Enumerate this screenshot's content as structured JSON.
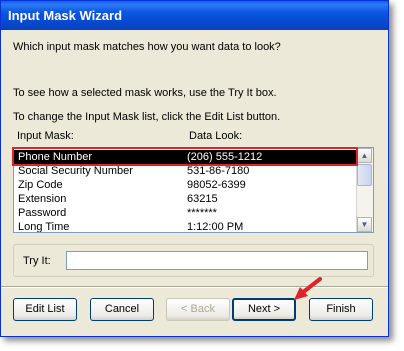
{
  "window": {
    "title": "Input Mask Wizard"
  },
  "instructions": {
    "question": "Which input mask matches how you want data to look?",
    "try_it_hint": "To see how a selected mask works, use the Try It box.",
    "edit_list_hint": "To change the Input Mask list, click the Edit List button."
  },
  "list": {
    "headers": {
      "mask": "Input Mask:",
      "look": "Data Look:"
    },
    "rows": [
      {
        "mask": "Phone Number",
        "look": "(206) 555-1212"
      },
      {
        "mask": "Social Security Number",
        "look": "531-86-7180"
      },
      {
        "mask": "Zip Code",
        "look": "98052-6399"
      },
      {
        "mask": "Extension",
        "look": "63215"
      },
      {
        "mask": "Password",
        "look": "*******"
      },
      {
        "mask": "Long Time",
        "look": "1:12:00 PM"
      }
    ],
    "selected_index": 0
  },
  "try_it": {
    "label": "Try It:",
    "value": ""
  },
  "buttons": {
    "edit_list": "Edit List",
    "cancel": "Cancel",
    "back": "< Back",
    "next": "Next >",
    "finish": "Finish"
  },
  "colors": {
    "title_bar": "#0a5ff0",
    "highlight_outline": "#e0232a",
    "annotation_arrow": "#e0232a"
  }
}
